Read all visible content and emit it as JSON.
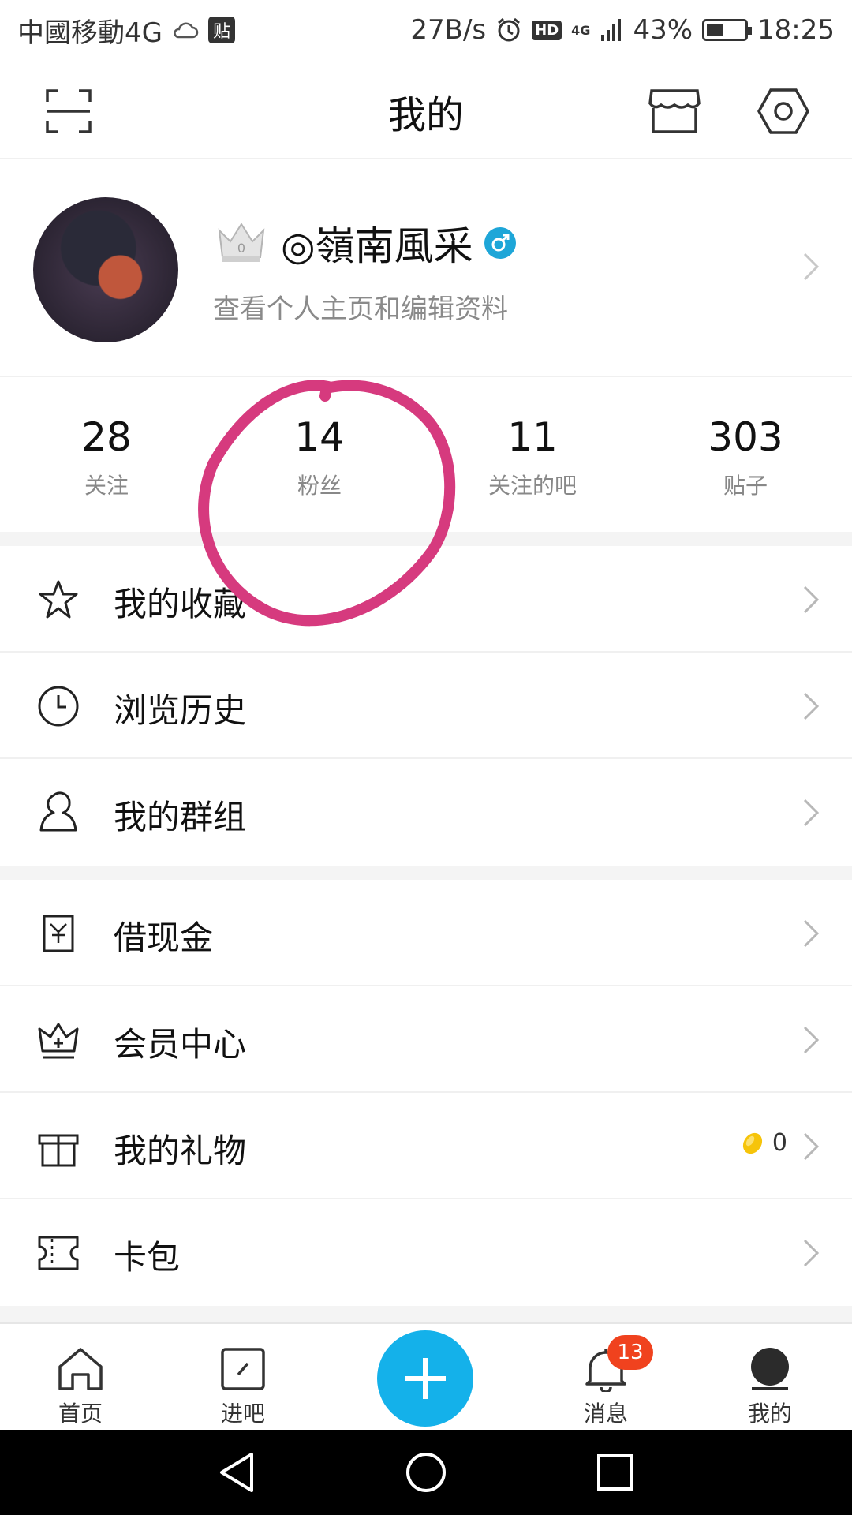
{
  "status_bar": {
    "carrier": "中國移動4G",
    "notif_icon": "贴",
    "speed": "27B/s",
    "hd": "HD",
    "network": "4G",
    "battery": "43%",
    "time": "18:25"
  },
  "header": {
    "title": "我的",
    "scan_icon": "scan-icon",
    "store_icon": "store-icon",
    "settings_icon": "settings-icon"
  },
  "profile": {
    "name": "◎嶺南風采",
    "subtitle": "查看个人主页和编辑资料"
  },
  "stats": [
    {
      "value": "28",
      "label": "关注"
    },
    {
      "value": "14",
      "label": "粉丝"
    },
    {
      "value": "11",
      "label": "关注的吧"
    },
    {
      "value": "303",
      "label": "贴子"
    }
  ],
  "menu_group1": [
    {
      "label": "我的收藏",
      "icon": "star-icon"
    },
    {
      "label": "浏览历史",
      "icon": "clock-icon"
    },
    {
      "label": "我的群组",
      "icon": "user-group-icon"
    }
  ],
  "menu_group2": [
    {
      "label": "借现金",
      "icon": "loan-icon"
    },
    {
      "label": "会员中心",
      "icon": "crown-icon"
    },
    {
      "label": "我的礼物",
      "icon": "gift-icon",
      "extra": "0"
    },
    {
      "label": "卡包",
      "icon": "ticket-icon"
    }
  ],
  "tabs": [
    {
      "label": "首页",
      "icon": "home-icon"
    },
    {
      "label": "进吧",
      "icon": "enter-icon"
    },
    {
      "label": "",
      "icon": "plus-icon"
    },
    {
      "label": "消息",
      "icon": "bell-icon",
      "badge": "13"
    },
    {
      "label": "我的",
      "icon": "person-icon"
    }
  ],
  "colors": {
    "accent": "#14b1ea",
    "badge": "#f0421e",
    "annotation": "#d63a7e",
    "verified": "#1ea6d8"
  }
}
